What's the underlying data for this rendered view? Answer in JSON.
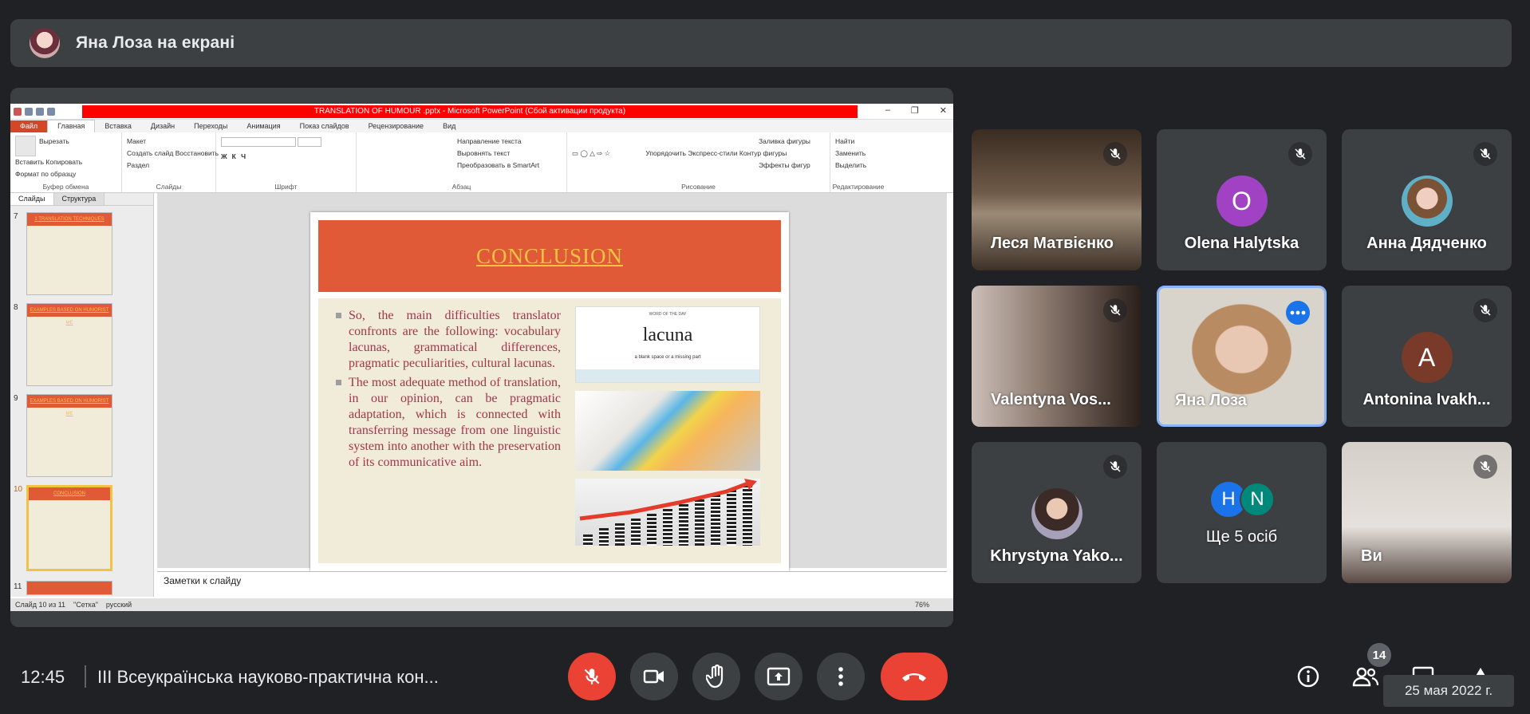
{
  "top_banner": {
    "presenter_text": "Яна Лоза на екрані"
  },
  "ppt": {
    "document_title": "TRANSLATION OF HUMOUR .pptx - Microsoft PowerPoint (Сбой активации продукта)",
    "tabs": [
      "Файл",
      "Главная",
      "Вставка",
      "Дизайн",
      "Переходы",
      "Анимация",
      "Показ слайдов",
      "Рецензирование",
      "Вид"
    ],
    "ribbon": {
      "clipboard": {
        "paste": "Вставить",
        "cut": "Вырезать",
        "copy": "Копировать",
        "format": "Формат по образцу",
        "group": "Буфер обмена"
      },
      "slides": {
        "new": "Создать слайд",
        "layout": "Макет",
        "reset": "Восстановить",
        "section": "Раздел",
        "group": "Слайды"
      },
      "font": {
        "group": "Шрифт"
      },
      "paragraph": {
        "dir": "Направление текста",
        "align": "Выровнять текст",
        "smartart": "Преобразовать в SmartArt",
        "group": "Абзац"
      },
      "drawing": {
        "arrange": "Упорядочить",
        "styles": "Экспресс-стили",
        "fill": "Заливка фигуры",
        "outline": "Контур фигуры",
        "effects": "Эффекты фигур",
        "group": "Рисование"
      },
      "editing": {
        "find": "Найти",
        "replace": "Заменить",
        "select": "Выделить",
        "group": "Редактирование"
      }
    },
    "pane_tabs": [
      "Слайды",
      "Структура"
    ],
    "thumbnails": [
      {
        "num": "7",
        "title": "1 TRANSLATION TECHNIQUES"
      },
      {
        "num": "8",
        "title": "EXAMPLES BASED ON HUMORIST ME"
      },
      {
        "num": "9",
        "title": "EXAMPLES BASED ON HUMORIST ME"
      },
      {
        "num": "10",
        "title": "CONCLUSION"
      },
      {
        "num": "11",
        "title": ""
      }
    ],
    "slide": {
      "title": "CONCLUSION",
      "bullet1": "So, the main difficulties translator confronts are the following: vocabulary lacunas, grammatical differences, pragmatic peculiarities, cultural lacunas.",
      "bullet2": "The most adequate method of translation, in our opinion, can be pragmatic adaptation, which is connected with transferring message from one linguistic system into another with the preservation of its communicative aim.",
      "image_word": "lacuna",
      "image_word_header": "WORD OF THE DAY",
      "image_word_def": "a blank space or a missing part"
    },
    "notes_placeholder": "Заметки к слайду",
    "status": {
      "slide": "Слайд 10 из 11",
      "theme": "\"Сетка\"",
      "lang": "русский",
      "zoom": "76%"
    }
  },
  "participants": [
    {
      "name": "Леся Матвієнко",
      "type": "video",
      "muted": true
    },
    {
      "name": "Olena Halytska",
      "type": "initial",
      "initial": "O",
      "color": "#a142c4",
      "muted": true
    },
    {
      "name": "Анна Дядченко",
      "type": "photo",
      "muted": true
    },
    {
      "name": "Valentyna Vos...",
      "type": "video",
      "muted": true
    },
    {
      "name": "Яна Лоза",
      "type": "video",
      "muted": false,
      "active": true
    },
    {
      "name": "Antonina Ivakh...",
      "type": "initial",
      "initial": "A",
      "color": "#7a3a2a",
      "muted": true
    },
    {
      "name": "Khrystyna Yako...",
      "type": "photo",
      "muted": true
    },
    {
      "name": "Ще 5 осіб",
      "type": "group",
      "initials": [
        "H",
        "N"
      ]
    },
    {
      "name": "Ви",
      "type": "video",
      "muted": true
    }
  ],
  "bottom": {
    "time": "12:45",
    "meeting_title": "ІІІ Всеукраїнська науково-практична кон...",
    "people_count": "14",
    "tooltip": "25 мая 2022 г."
  }
}
